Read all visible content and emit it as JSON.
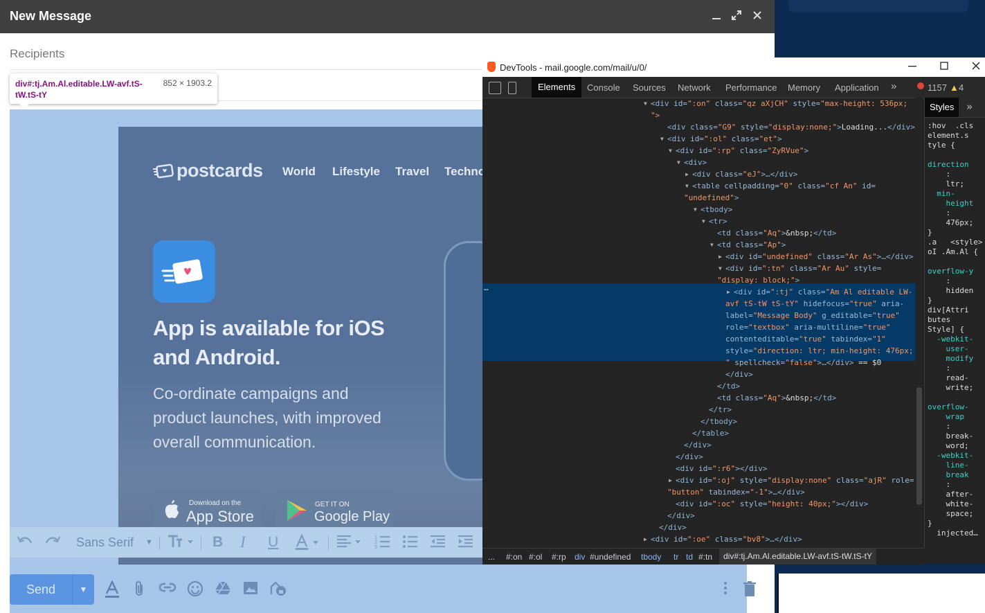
{
  "compose": {
    "title": "New Message",
    "recipients_placeholder": "Recipients",
    "header_icons": [
      "minimize-icon",
      "pop-out-icon",
      "close-icon"
    ]
  },
  "tooltip": {
    "selector": "div#:tj.Am.Al.editable.LW-avf.tS-tW.tS-tY",
    "dimensions": "852 × 1903.2"
  },
  "email": {
    "brand": "postcards",
    "nav": [
      "World",
      "Lifestyle",
      "Travel",
      "Techno"
    ],
    "headline": "App is available for iOS and Android.",
    "subtext": "Co-ordinate campaigns and product launches, with improved overall communication.",
    "app_store": {
      "small": "Download on the",
      "big": "App Store"
    },
    "google_play": {
      "small": "GET IT ON",
      "big": "Google Play"
    }
  },
  "toolbar": {
    "font": "Sans Serif",
    "icons": [
      "undo-icon",
      "redo-icon",
      "font-select",
      "text-size-icon",
      "bold-icon",
      "italic-icon",
      "underline-icon",
      "text-color-icon",
      "align-icon",
      "numbered-list-icon",
      "bulleted-list-icon",
      "indent-less-icon",
      "indent-more-icon"
    ]
  },
  "bottom": {
    "send": "Send",
    "icons": [
      "formatting-options-icon",
      "attach-file-icon",
      "insert-link-icon",
      "insert-emoji-icon",
      "google-drive-icon",
      "insert-photo-icon",
      "confidential-mode-icon",
      "more-options-icon",
      "discard-draft-icon"
    ]
  },
  "devtools": {
    "title": "DevTools - mail.google.com/mail/u/0/",
    "tabs": [
      "Elements",
      "Console",
      "Sources",
      "Network",
      "Performance",
      "Memory",
      "Application"
    ],
    "more": "»",
    "errors": "1157",
    "warnings": "4",
    "dom_lines": [
      {
        "indent": 0,
        "arrow": "▼",
        "parts": [
          [
            "t",
            "<div "
          ],
          [
            "a",
            "id="
          ],
          [
            "v",
            "\":on\" "
          ],
          [
            "a",
            "class="
          ],
          [
            "v",
            "\"qz aXjCH\" "
          ],
          [
            "a",
            "style="
          ],
          [
            "v",
            "\"max-height: 536px;"
          ]
        ]
      },
      {
        "indent": 0,
        "arrow": "",
        "parts": [
          [
            "v",
            "\">"
          ]
        ]
      },
      {
        "indent": 2,
        "arrow": "",
        "parts": [
          [
            "t",
            "<div "
          ],
          [
            "a",
            "class="
          ],
          [
            "v",
            "\"G9\" "
          ],
          [
            "a",
            "style="
          ],
          [
            "v",
            "\"display:none;\""
          ],
          [
            "t",
            ">"
          ],
          [
            "x",
            "Loading..."
          ],
          [
            "t",
            "</div>"
          ]
        ]
      },
      {
        "indent": 2,
        "arrow": "▼",
        "parts": [
          [
            "t",
            "<div "
          ],
          [
            "a",
            "id="
          ],
          [
            "v",
            "\":ol\" "
          ],
          [
            "a",
            "class="
          ],
          [
            "v",
            "\"et\""
          ],
          [
            "t",
            ">"
          ]
        ]
      },
      {
        "indent": 3,
        "arrow": "▼",
        "parts": [
          [
            "t",
            "<div "
          ],
          [
            "a",
            "id="
          ],
          [
            "v",
            "\":rp\" "
          ],
          [
            "a",
            "class="
          ],
          [
            "v",
            "\"ZyRVue\""
          ],
          [
            "t",
            ">"
          ]
        ]
      },
      {
        "indent": 4,
        "arrow": "▼",
        "parts": [
          [
            "t",
            "<div>"
          ]
        ]
      },
      {
        "indent": 5,
        "arrow": "▶",
        "parts": [
          [
            "t",
            "<div "
          ],
          [
            "a",
            "class="
          ],
          [
            "v",
            "\"eJ\""
          ],
          [
            "t",
            ">…</div>"
          ]
        ]
      },
      {
        "indent": 5,
        "arrow": "▼",
        "parts": [
          [
            "t",
            "<table "
          ],
          [
            "a",
            "cellpadding="
          ],
          [
            "v",
            "\"0\" "
          ],
          [
            "a",
            "class="
          ],
          [
            "v",
            "\"cf An\" "
          ],
          [
            "a",
            "id="
          ]
        ]
      },
      {
        "indent": 4,
        "arrow": "",
        "parts": [
          [
            "v",
            "\"undefined\""
          ],
          [
            "t",
            ">"
          ]
        ]
      },
      {
        "indent": 6,
        "arrow": "▼",
        "parts": [
          [
            "t",
            "<tbody>"
          ]
        ]
      },
      {
        "indent": 7,
        "arrow": "▼",
        "parts": [
          [
            "t",
            "<tr>"
          ]
        ]
      },
      {
        "indent": 8,
        "arrow": "",
        "parts": [
          [
            "t",
            "<td "
          ],
          [
            "a",
            "class="
          ],
          [
            "v",
            "\"Aq\""
          ],
          [
            "t",
            ">"
          ],
          [
            "x",
            "&nbsp;"
          ],
          [
            "t",
            "</td>"
          ]
        ]
      },
      {
        "indent": 8,
        "arrow": "▼",
        "parts": [
          [
            "t",
            "<td "
          ],
          [
            "a",
            "class="
          ],
          [
            "v",
            "\"Ap\""
          ],
          [
            "t",
            ">"
          ]
        ]
      },
      {
        "indent": 9,
        "arrow": "▶",
        "parts": [
          [
            "t",
            "<div "
          ],
          [
            "a",
            "id="
          ],
          [
            "v",
            "\"undefined\" "
          ],
          [
            "a",
            "class="
          ],
          [
            "v",
            "\"Ar As\""
          ],
          [
            "t",
            ">…</div>"
          ]
        ]
      },
      {
        "indent": 9,
        "arrow": "▼",
        "parts": [
          [
            "t",
            "<div "
          ],
          [
            "a",
            "id="
          ],
          [
            "v",
            "\":tn\" "
          ],
          [
            "a",
            "class="
          ],
          [
            "v",
            "\"Ar Au\" "
          ],
          [
            "a",
            "style="
          ]
        ]
      },
      {
        "indent": 8,
        "arrow": "",
        "parts": [
          [
            "v",
            "\"display: block;\""
          ],
          [
            "t",
            ">"
          ]
        ]
      },
      {
        "indent": 10,
        "arrow": "▶",
        "parts": [
          [
            "t",
            "<div "
          ],
          [
            "a",
            "id="
          ],
          [
            "v",
            "\":tj\" "
          ],
          [
            "a",
            "class="
          ],
          [
            "v",
            "\"Am Al editable LW-"
          ]
        ]
      },
      {
        "indent": 9,
        "arrow": "",
        "parts": [
          [
            "v",
            "avf tS-tW tS-tY\" "
          ],
          [
            "a",
            "hidefocus="
          ],
          [
            "v",
            "\"true\" "
          ],
          [
            "a",
            "aria-"
          ]
        ]
      },
      {
        "indent": 9,
        "arrow": "",
        "parts": [
          [
            "a",
            "label="
          ],
          [
            "v",
            "\"Message Body\" "
          ],
          [
            "a",
            "g_editable="
          ],
          [
            "v",
            "\"true\""
          ]
        ]
      },
      {
        "indent": 9,
        "arrow": "",
        "parts": [
          [
            "a",
            "role="
          ],
          [
            "v",
            "\"textbox\" "
          ],
          [
            "a",
            "aria-multiline="
          ],
          [
            "v",
            "\"true\""
          ]
        ]
      },
      {
        "indent": 9,
        "arrow": "",
        "parts": [
          [
            "a",
            "contenteditable="
          ],
          [
            "v",
            "\"true\" "
          ],
          [
            "a",
            "tabindex="
          ],
          [
            "v",
            "\"1\""
          ]
        ]
      },
      {
        "indent": 9,
        "arrow": "",
        "parts": [
          [
            "a",
            "style="
          ],
          [
            "v",
            "\"direction: ltr; min-height: 476px;"
          ]
        ]
      },
      {
        "indent": 9,
        "arrow": "",
        "parts": [
          [
            "v",
            "\" "
          ],
          [
            "a",
            "spellcheck="
          ],
          [
            "v",
            "\"false\""
          ],
          [
            "t",
            ">…</div>"
          ],
          [
            "x",
            " == $0"
          ]
        ]
      },
      {
        "indent": 9,
        "arrow": "",
        "parts": [
          [
            "t",
            "</div>"
          ]
        ]
      },
      {
        "indent": 8,
        "arrow": "",
        "parts": [
          [
            "t",
            "</td>"
          ]
        ]
      },
      {
        "indent": 8,
        "arrow": "",
        "parts": [
          [
            "t",
            "<td "
          ],
          [
            "a",
            "class="
          ],
          [
            "v",
            "\"Aq\""
          ],
          [
            "t",
            ">"
          ],
          [
            "x",
            "&nbsp;"
          ],
          [
            "t",
            "</td>"
          ]
        ]
      },
      {
        "indent": 7,
        "arrow": "",
        "parts": [
          [
            "t",
            "</tr>"
          ]
        ]
      },
      {
        "indent": 6,
        "arrow": "",
        "parts": [
          [
            "t",
            "</tbody>"
          ]
        ]
      },
      {
        "indent": 5,
        "arrow": "",
        "parts": [
          [
            "t",
            "</table>"
          ]
        ]
      },
      {
        "indent": 4,
        "arrow": "",
        "parts": [
          [
            "t",
            "</div>"
          ]
        ]
      },
      {
        "indent": 3,
        "arrow": "",
        "parts": [
          [
            "t",
            "</div>"
          ]
        ]
      },
      {
        "indent": 3,
        "arrow": "",
        "parts": [
          [
            "t",
            "<div "
          ],
          [
            "a",
            "id="
          ],
          [
            "v",
            "\":r6\""
          ],
          [
            "t",
            "></div>"
          ]
        ]
      },
      {
        "indent": 3,
        "arrow": "▶",
        "parts": [
          [
            "t",
            "<div "
          ],
          [
            "a",
            "id="
          ],
          [
            "v",
            "\":oj\" "
          ],
          [
            "a",
            "style="
          ],
          [
            "v",
            "\"display:none\" "
          ],
          [
            "a",
            "class="
          ],
          [
            "v",
            "\"ajR\" "
          ],
          [
            "a",
            "role="
          ]
        ]
      },
      {
        "indent": 2,
        "arrow": "",
        "parts": [
          [
            "v",
            "\"button\" "
          ],
          [
            "a",
            "tabindex="
          ],
          [
            "v",
            "\"-1\""
          ],
          [
            "t",
            ">…</div>"
          ]
        ]
      },
      {
        "indent": 3,
        "arrow": "",
        "parts": [
          [
            "t",
            "<div "
          ],
          [
            "a",
            "id="
          ],
          [
            "v",
            "\":oc\" "
          ],
          [
            "a",
            "style="
          ],
          [
            "v",
            "\"height: 40px;\""
          ],
          [
            "t",
            "></div>"
          ]
        ]
      },
      {
        "indent": 2,
        "arrow": "",
        "parts": [
          [
            "t",
            "</div>"
          ]
        ]
      },
      {
        "indent": 1,
        "arrow": "",
        "parts": [
          [
            "t",
            "</div>"
          ]
        ]
      },
      {
        "indent": 0,
        "arrow": "▶",
        "parts": [
          [
            "t",
            "<div "
          ],
          [
            "a",
            "id="
          ],
          [
            "v",
            "\":oe\" "
          ],
          [
            "a",
            "class="
          ],
          [
            "v",
            "\"bv8\""
          ],
          [
            "t",
            ">…</div>"
          ]
        ]
      },
      {
        "indent": 0,
        "arrow": "",
        "parts": [
          [
            "t",
            "</div>"
          ]
        ]
      }
    ],
    "styles_tab": "Styles",
    "styles_lines": [
      {
        "c": "x",
        "t": ":hov  .cls"
      },
      {
        "c": "s",
        "t": "element.s"
      },
      {
        "c": "s",
        "t": "tyle {"
      },
      {
        "c": "s",
        "t": ""
      },
      {
        "c": "p",
        "t": "direction"
      },
      {
        "c": "x",
        "t": "    :"
      },
      {
        "c": "x",
        "t": "    ltr;"
      },
      {
        "c": "p",
        "t": "  min-"
      },
      {
        "c": "p",
        "t": "    height"
      },
      {
        "c": "x",
        "t": "    :"
      },
      {
        "c": "x",
        "t": "    476px;"
      },
      {
        "c": "s",
        "t": "}"
      },
      {
        "c": "s",
        "t": ".a   <style>"
      },
      {
        "c": "s",
        "t": "oI .Am.Al {"
      },
      {
        "c": "s",
        "t": ""
      },
      {
        "c": "p",
        "t": "overflow-y"
      },
      {
        "c": "x",
        "t": "    :"
      },
      {
        "c": "x",
        "t": "    hidden"
      },
      {
        "c": "s",
        "t": "}"
      },
      {
        "c": "s",
        "t": "div[Attri"
      },
      {
        "c": "s",
        "t": "butes"
      },
      {
        "c": "s",
        "t": "Style] {"
      },
      {
        "c": "p",
        "t": "  -webkit-"
      },
      {
        "c": "p",
        "t": "    user-"
      },
      {
        "c": "p",
        "t": "    modify"
      },
      {
        "c": "x",
        "t": "    :"
      },
      {
        "c": "x",
        "t": "    read-"
      },
      {
        "c": "x",
        "t": "    write;"
      },
      {
        "c": "s",
        "t": ""
      },
      {
        "c": "p",
        "t": "overflow-"
      },
      {
        "c": "p",
        "t": "    wrap"
      },
      {
        "c": "x",
        "t": "    :"
      },
      {
        "c": "x",
        "t": "    break-"
      },
      {
        "c": "x",
        "t": "    word;"
      },
      {
        "c": "p",
        "t": "  -webkit-"
      },
      {
        "c": "p",
        "t": "    line-"
      },
      {
        "c": "p",
        "t": "    break"
      },
      {
        "c": "x",
        "t": "    :"
      },
      {
        "c": "x",
        "t": "    after-"
      },
      {
        "c": "x",
        "t": "    white-"
      },
      {
        "c": "x",
        "t": "    space;"
      },
      {
        "c": "s",
        "t": "}"
      },
      {
        "c": "s",
        "t": "  injected…"
      }
    ],
    "breadcrumbs": [
      "...",
      "#:on",
      "#:ol",
      "#:rp",
      "div",
      "#undefined",
      "tbody",
      "tr",
      "td",
      "#:tn",
      "div#:tj.Am.Al.editable.LW-avf.tS-tW.tS-tY"
    ]
  },
  "colors": {
    "compose_header": "#404040",
    "selection_overlay": "#a6c5e8",
    "send_button": "#5b95e1",
    "devtools_bg": "#242424",
    "selected_node": "#063a66",
    "tag_color": "#881280"
  }
}
